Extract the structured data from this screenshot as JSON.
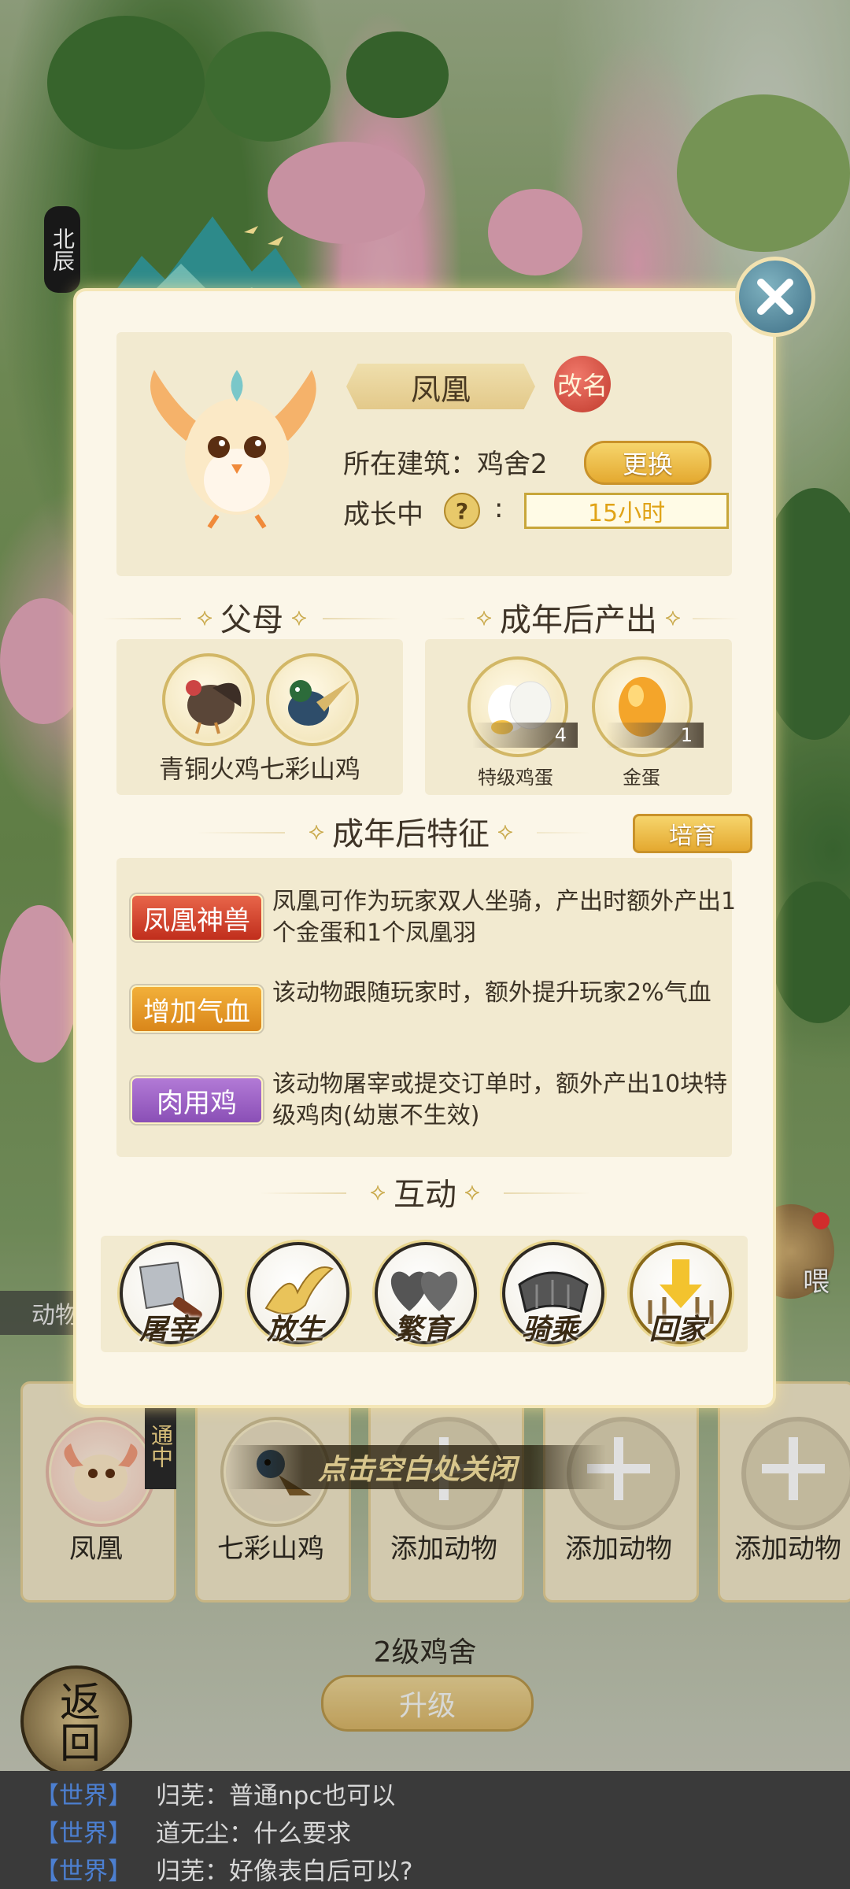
{
  "pet": {
    "name": "凤凰",
    "rename_label": "改名",
    "building_text": "所在建筑：鸡舍2",
    "change_label": "更换",
    "growth_label": "成长中",
    "help_symbol": "?",
    "colon": ":",
    "growth_time": "15小时"
  },
  "sections": {
    "parents_title": "父母",
    "output_title": "成年后产出",
    "traits_title": "成年后特征",
    "cultivate_label": "培育",
    "interact_title": "互动"
  },
  "parents": {
    "names": "青铜火鸡七彩山鸡"
  },
  "outputs": [
    {
      "name": "特级鸡蛋",
      "count": "4"
    },
    {
      "name": "金蛋",
      "count": "1"
    }
  ],
  "traits": [
    {
      "badge": "凤凰神兽",
      "desc": "凤凰可作为玩家双人坐骑，产出时额外产出1个金蛋和1个凤凰羽",
      "color": "#d5432b"
    },
    {
      "badge": "增加气血",
      "desc": "该动物跟随玩家时，额外提升玩家2%气血",
      "color": "#e0901f"
    },
    {
      "badge": "肉用鸡",
      "desc": "该动物屠宰或提交订单时，额外产出10块特级鸡肉(幼崽不生效)",
      "color": "#9b5fc4"
    }
  ],
  "actions": [
    {
      "label": "屠宰",
      "icon": "cleaver-icon"
    },
    {
      "label": "放生",
      "icon": "bird-icon"
    },
    {
      "label": "繁育",
      "icon": "hearts-icon"
    },
    {
      "label": "骑乘",
      "icon": "saddle-icon"
    },
    {
      "label": "回家",
      "icon": "home-arrow-icon"
    }
  ],
  "hint": "点击空白处关闭",
  "left_banner": "北辰",
  "side_tab": "动物",
  "slots": [
    {
      "label": "凤凰"
    },
    {
      "label": "七彩山鸡"
    },
    {
      "label": "添加动物"
    },
    {
      "label": "添加动物"
    },
    {
      "label": "添加动物"
    }
  ],
  "slot_badge": "通中",
  "building": {
    "level_title": "2级鸡舍",
    "upgrade_label": "升级"
  },
  "back_label": "返回",
  "right_btn_fragment": "喂",
  "chat": [
    {
      "tag": "【世界】",
      "user": "归芜",
      "text": "：普通npc也可以"
    },
    {
      "tag": "【世界】",
      "user": "道无尘",
      "text": "：什么要求"
    },
    {
      "tag": "【世界】",
      "user": "归芜",
      "text": "：好像表白后可以?"
    }
  ]
}
